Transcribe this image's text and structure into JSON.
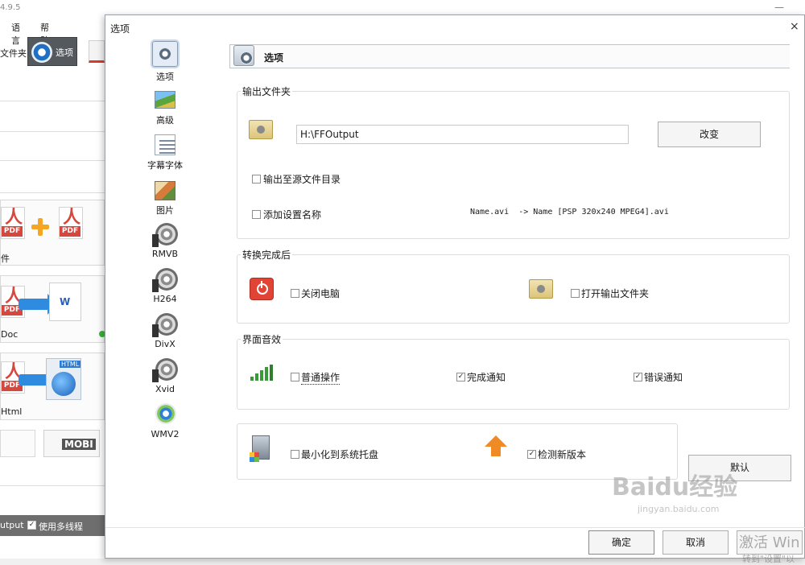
{
  "background_app": {
    "version": "4.9.5",
    "menu": [
      "语言",
      "帮助"
    ],
    "toolbar": {
      "folder_label": "文件夹",
      "options_label": "选项"
    },
    "cards": [
      {
        "label": "件"
      },
      {
        "label": "Doc"
      },
      {
        "label": "Html"
      }
    ],
    "mobi_label": "MOBI",
    "pdf_badge": "PDF",
    "word_letter": "W",
    "html_tag": "HTML",
    "status": {
      "output_label": "utput",
      "multithread_label": "使用多线程",
      "multithread_checked": true
    }
  },
  "dialog": {
    "title": "选项",
    "close_glyph": "×",
    "nav": [
      {
        "label": "选项",
        "icon": "options-icon",
        "active": true
      },
      {
        "label": "高级",
        "icon": "advanced-icon"
      },
      {
        "label": "字幕字体",
        "icon": "subtitle-font-icon"
      },
      {
        "label": "图片",
        "icon": "picture-icon"
      },
      {
        "label": "RMVB",
        "icon": "film-reel-icon"
      },
      {
        "label": "H264",
        "icon": "film-reel-icon"
      },
      {
        "label": "DivX",
        "icon": "film-reel-icon"
      },
      {
        "label": "Xvid",
        "icon": "film-reel-icon"
      },
      {
        "label": "WMV2",
        "icon": "wmv-icon"
      }
    ],
    "header": {
      "title": "选项"
    },
    "output_folder": {
      "title": "输出文件夹",
      "path": "H:\\FFOutput",
      "change_button": "改变",
      "output_to_source": {
        "label": "输出至源文件目录",
        "checked": false
      },
      "add_setting_name": {
        "label": "添加设置名称",
        "checked": false
      },
      "sample": "Name.avi  -> Name [PSP 320x240 MPEG4].avi"
    },
    "after_conversion": {
      "title": "转换完成后",
      "shutdown": {
        "label": "关闭电脑",
        "checked": false
      },
      "open_output": {
        "label": "打开输出文件夹",
        "checked": false
      }
    },
    "sound": {
      "title": "界面音效",
      "normal_op": {
        "label": "普通操作",
        "checked": false
      },
      "complete": {
        "label": "完成通知",
        "checked": true
      },
      "error": {
        "label": "错误通知",
        "checked": true
      }
    },
    "misc": {
      "minimize_tray": {
        "label": "最小化到系统托盘",
        "checked": false
      },
      "check_update": {
        "label": "检测新版本",
        "checked": true
      }
    },
    "default_button": "默认",
    "ok_button": "确定",
    "cancel_button": "取消",
    "watermark": {
      "brand": "Baidu经验",
      "url": "jingyan.baidu.com"
    },
    "activate_windows": {
      "title": "激活 Win",
      "subtitle": "转到\"设置\"以"
    }
  },
  "colors": {
    "accent": "#2f8be0",
    "pdf_red": "#d6473d",
    "power_red": "#e14434"
  }
}
